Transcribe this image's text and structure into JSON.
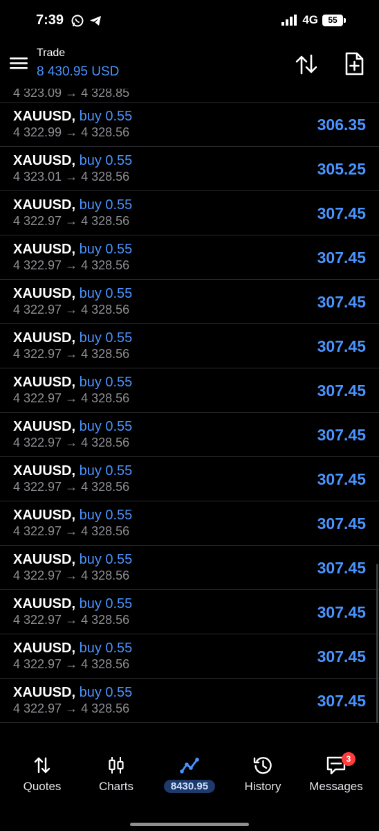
{
  "status_bar": {
    "time": "7:39",
    "network": "4G",
    "battery": "55"
  },
  "header": {
    "title": "Trade",
    "balance": "8 430.95 USD"
  },
  "partial_row": {
    "prices": "4 323.09 → 4 328.85"
  },
  "trades": [
    {
      "symbol": "XAUUSD",
      "side": "buy 0.55",
      "open": "4 322.99",
      "arrow": "→",
      "current": "4 328.56",
      "profit": "306.35"
    },
    {
      "symbol": "XAUUSD",
      "side": "buy 0.55",
      "open": "4 323.01",
      "arrow": "→",
      "current": "4 328.56",
      "profit": "305.25"
    },
    {
      "symbol": "XAUUSD",
      "side": "buy 0.55",
      "open": "4 322.97",
      "arrow": "→",
      "current": "4 328.56",
      "profit": "307.45"
    },
    {
      "symbol": "XAUUSD",
      "side": "buy 0.55",
      "open": "4 322.97",
      "arrow": "→",
      "current": "4 328.56",
      "profit": "307.45"
    },
    {
      "symbol": "XAUUSD",
      "side": "buy 0.55",
      "open": "4 322.97",
      "arrow": "→",
      "current": "4 328.56",
      "profit": "307.45"
    },
    {
      "symbol": "XAUUSD",
      "side": "buy 0.55",
      "open": "4 322.97",
      "arrow": "→",
      "current": "4 328.56",
      "profit": "307.45"
    },
    {
      "symbol": "XAUUSD",
      "side": "buy 0.55",
      "open": "4 322.97",
      "arrow": "→",
      "current": "4 328.56",
      "profit": "307.45"
    },
    {
      "symbol": "XAUUSD",
      "side": "buy 0.55",
      "open": "4 322.97",
      "arrow": "→",
      "current": "4 328.56",
      "profit": "307.45"
    },
    {
      "symbol": "XAUUSD",
      "side": "buy 0.55",
      "open": "4 322.97",
      "arrow": "→",
      "current": "4 328.56",
      "profit": "307.45"
    },
    {
      "symbol": "XAUUSD",
      "side": "buy 0.55",
      "open": "4 322.97",
      "arrow": "→",
      "current": "4 328.56",
      "profit": "307.45"
    },
    {
      "symbol": "XAUUSD",
      "side": "buy 0.55",
      "open": "4 322.97",
      "arrow": "→",
      "current": "4 328.56",
      "profit": "307.45"
    },
    {
      "symbol": "XAUUSD",
      "side": "buy 0.55",
      "open": "4 322.97",
      "arrow": "→",
      "current": "4 328.56",
      "profit": "307.45"
    },
    {
      "symbol": "XAUUSD",
      "side": "buy 0.55",
      "open": "4 322.97",
      "arrow": "→",
      "current": "4 328.56",
      "profit": "307.45"
    },
    {
      "symbol": "XAUUSD",
      "side": "buy 0.55",
      "open": "4 322.97",
      "arrow": "→",
      "current": "4 328.56",
      "profit": "307.45"
    }
  ],
  "bottom_nav": {
    "quotes": "Quotes",
    "charts": "Charts",
    "trade_pill": "8430.95",
    "history": "History",
    "messages": "Messages",
    "messages_badge": "3"
  },
  "colors": {
    "accent": "#4a94ff",
    "background": "#000000",
    "muted_text": "#8e8e93",
    "badge": "#ff3b3b"
  },
  "icons": {
    "status_left": [
      "whatsapp-icon",
      "telegram-icon"
    ],
    "status_right": [
      "signal-icon",
      "battery-icon"
    ],
    "header": [
      "menu-icon",
      "sort-icon",
      "new-order-icon"
    ],
    "nav": [
      "quotes-icon",
      "charts-icon",
      "trade-icon",
      "history-icon",
      "messages-icon"
    ]
  }
}
